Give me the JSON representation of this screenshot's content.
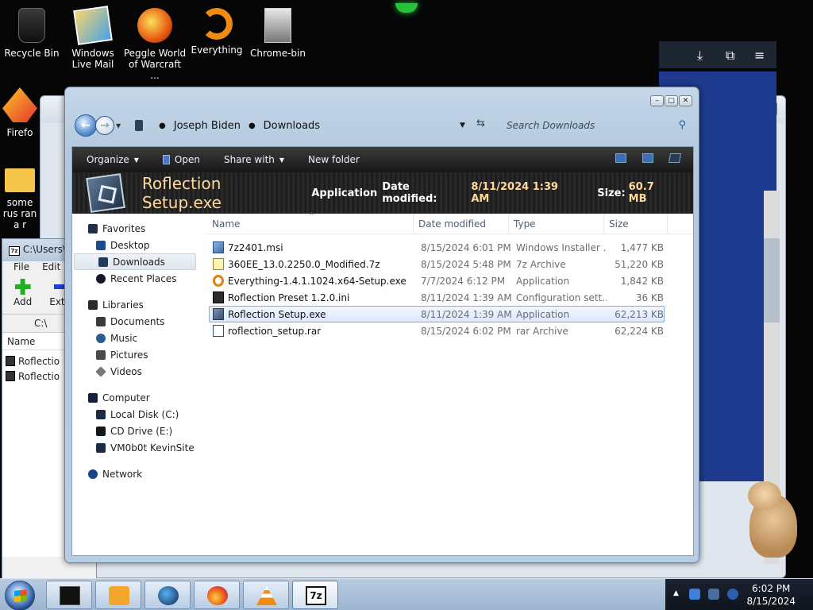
{
  "desktop": {
    "icons": [
      {
        "label": "Recycle Bin",
        "icon": "recycle-bin-icon"
      },
      {
        "label": "Windows Live Mail",
        "icon": "mail-icon"
      },
      {
        "label": "Peggle World of Warcraft ...",
        "icon": "peggle-icon"
      },
      {
        "label": "Everything",
        "icon": "everything-icon"
      },
      {
        "label": "Chrome-bin",
        "icon": "folder-icon"
      },
      {
        "label": "Firefo",
        "icon": "firefox-icon"
      },
      {
        "label": "some rus ran a r",
        "icon": "folder-icon"
      }
    ]
  },
  "sevenzip": {
    "title": "C:\\Users\\",
    "menu": [
      "File",
      "Edit"
    ],
    "tools": [
      "Add",
      "Extra"
    ],
    "address": "C:\\",
    "column": "Name",
    "files": [
      "Roflectio",
      "Roflectio"
    ]
  },
  "explorer": {
    "breadcrumb": [
      "Joseph Biden",
      "Downloads"
    ],
    "search_placeholder": "Search Downloads",
    "commands": {
      "organize": "Organize",
      "open": "Open",
      "share": "Share with",
      "new_folder": "New folder"
    },
    "details": {
      "name": "Roflection Setup.exe",
      "type": "Application",
      "date_label": "Date modified:",
      "date_value": "8/11/2024 1:39 AM",
      "size_label": "Size:",
      "size_value": "60.7 MB"
    },
    "nav": {
      "favorites": "Favorites",
      "desktop": "Desktop",
      "downloads": "Downloads",
      "recent": "Recent Places",
      "libraries": "Libraries",
      "documents": "Documents",
      "music": "Music",
      "pictures": "Pictures",
      "videos": "Videos",
      "computer": "Computer",
      "local_disk": "Local Disk (C:)",
      "cd_drive": "CD Drive (E:)",
      "vm": "VM0b0t KevinSite",
      "network": "Network"
    },
    "columns": {
      "name": "Name",
      "date": "Date modified",
      "type": "Type",
      "size": "Size"
    },
    "files": [
      {
        "name": "7z2401.msi",
        "date": "8/15/2024 6:01 PM",
        "type": "Windows Installer ...",
        "size": "1,477 KB",
        "icon": "msi-file-icon"
      },
      {
        "name": "360EE_13.0.2250.0_Modified.7z",
        "date": "8/15/2024 5:48 PM",
        "type": "7z Archive",
        "size": "51,220 KB",
        "icon": "archive-file-icon"
      },
      {
        "name": "Everything-1.4.1.1024.x64-Setup.exe",
        "date": "7/7/2024 6:12 PM",
        "type": "Application",
        "size": "1,842 KB",
        "icon": "everything-setup-icon"
      },
      {
        "name": "Roflection Preset 1.2.0.ini",
        "date": "8/11/2024 1:39 AM",
        "type": "Configuration sett...",
        "size": "36 KB",
        "icon": "ini-file-icon"
      },
      {
        "name": "Roflection Setup.exe",
        "date": "8/11/2024 1:39 AM",
        "type": "Application",
        "size": "62,213 KB",
        "icon": "exe-file-icon"
      },
      {
        "name": "roflection_setup.rar",
        "date": "8/15/2024 6:02 PM",
        "type": "rar Archive",
        "size": "62,224 KB",
        "icon": "rar-file-icon"
      }
    ]
  },
  "taskbar": {
    "clock_time": "6:02 PM",
    "clock_date": "8/15/2024",
    "pinned_7z_text": "7z"
  }
}
